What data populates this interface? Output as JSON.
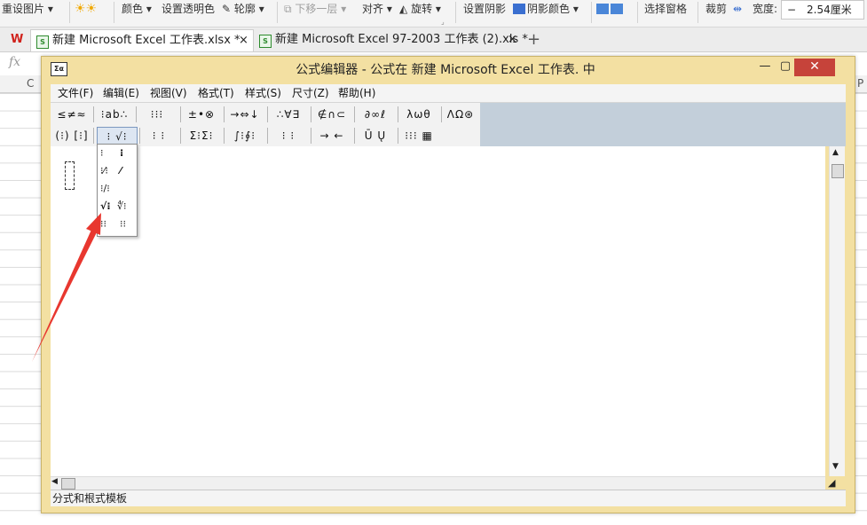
{
  "ribbon": {
    "reset_picture": "重设图片",
    "color": "颜色",
    "set_transparent": "设置透明色",
    "outline": "轮廓",
    "move_down": "下移一层",
    "align": "对齐",
    "rotate": "旋转",
    "set_shadow": "设置阴影",
    "shadow_color": "阴影颜色",
    "selection_pane": "选择窗格",
    "crop": "裁剪",
    "width_label": "宽度:",
    "width_minus": "−",
    "width_value": "2.54厘米"
  },
  "tabs": {
    "tab1": "新建 Microsoft Excel 工作表.xlsx *",
    "tab2": "新建 Microsoft Excel 97-2003 工作表 (2).xls *",
    "close": "×",
    "new_tab": "+"
  },
  "sheet": {
    "fx": "fx",
    "col_c": "C",
    "col_p": "P"
  },
  "editor": {
    "title": "公式编辑器 - 公式在 新建 Microsoft Excel 工作表. 中",
    "menus": [
      "文件(F)",
      "编辑(E)",
      "视图(V)",
      "格式(T)",
      "样式(S)",
      "尺寸(Z)",
      "帮助(H)"
    ],
    "status": "分式和根式模板",
    "toolbar_row1": [
      "≤≠≈",
      "⁝ab∴",
      "⁝⁝⁝",
      "±•⊗",
      "→⇔↓",
      "∴∀∃",
      "∉∩⊂",
      "∂∞ℓ",
      "λωθ",
      "ΛΩ⊛"
    ],
    "toolbar_row2": [
      "(⁝) [⁝]",
      "⁝ √⁝",
      "⁝ ⁝",
      "Σ⁝Σ⁝",
      "∫⁝∮⁝",
      "⁝ ⁝",
      "→ ←",
      "Ū Ų",
      "⁝⁝⁝ ▦"
    ]
  }
}
